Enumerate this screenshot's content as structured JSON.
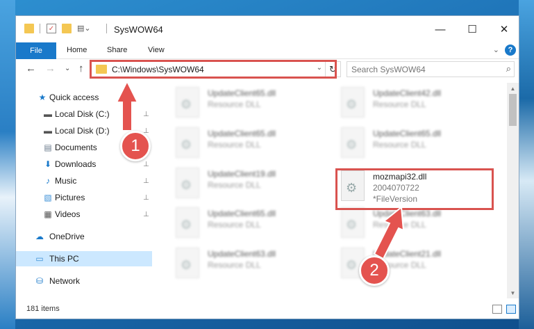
{
  "window": {
    "title": "SysWOW64",
    "minimize": "—",
    "maximize": "☐",
    "close": "✕"
  },
  "ribbon": {
    "tabs": [
      "File",
      "Home",
      "Share",
      "View"
    ],
    "expand": "⌄",
    "help": "?"
  },
  "nav": {
    "back": "←",
    "forward": "→",
    "recent": "⌄",
    "up": "↑",
    "address": "C:\\Windows\\SysWOW64",
    "address_dropdown": "⌄",
    "refresh": "↻",
    "search_placeholder": "Search SysWOW64",
    "search_icon": "⌕"
  },
  "sidebar": {
    "items": [
      {
        "label": "Quick access",
        "icon": "★",
        "icon_name": "star-icon",
        "pinned": false
      },
      {
        "label": "Local Disk (C:)",
        "icon": "▬",
        "icon_name": "drive-icon",
        "pinned": true
      },
      {
        "label": "Local Disk (D:)",
        "icon": "▬",
        "icon_name": "drive-icon",
        "pinned": true
      },
      {
        "label": "Documents",
        "icon": "▤",
        "icon_name": "documents-icon",
        "pinned": true
      },
      {
        "label": "Downloads",
        "icon": "⬇",
        "icon_name": "downloads-icon",
        "pinned": true
      },
      {
        "label": "Music",
        "icon": "♪",
        "icon_name": "music-icon",
        "pinned": true
      },
      {
        "label": "Pictures",
        "icon": "▧",
        "icon_name": "pictures-icon",
        "pinned": true
      },
      {
        "label": "Videos",
        "icon": "▦",
        "icon_name": "videos-icon",
        "pinned": true
      },
      {
        "label": "OneDrive",
        "icon": "☁",
        "icon_name": "onedrive-icon",
        "pinned": false
      },
      {
        "label": "This PC",
        "icon": "▭",
        "icon_name": "computer-icon",
        "pinned": false
      },
      {
        "label": "Network",
        "icon": "⛁",
        "icon_name": "network-icon",
        "pinned": false
      }
    ],
    "pin_glyph": "📌"
  },
  "files": [
    {
      "name": "UpdateClient65.dll",
      "sub1": "Resource DLL",
      "sub2": ""
    },
    {
      "name": "UpdateClient42.dll",
      "sub1": "Resource DLL",
      "sub2": ""
    },
    {
      "name": "UpdateClient65.dll",
      "sub1": "Resource DLL",
      "sub2": ""
    },
    {
      "name": "UpdateClient65.dll",
      "sub1": "Resource DLL",
      "sub2": ""
    },
    {
      "name": "UpdateClient19.dll",
      "sub1": "Resource DLL",
      "sub2": ""
    },
    {
      "name": "mozmapi32.dll",
      "sub1": "2004070722",
      "sub2": "*FileVersion"
    },
    {
      "name": "UpdateClient65.dll",
      "sub1": "Resource DLL",
      "sub2": ""
    },
    {
      "name": "UpdateClient63.dll",
      "sub1": "Resource DLL",
      "sub2": ""
    },
    {
      "name": "UpdateClient63.dll",
      "sub1": "Resource DLL",
      "sub2": ""
    },
    {
      "name": "UpdateClient21.dll",
      "sub1": "Resource DLL",
      "sub2": ""
    }
  ],
  "status": {
    "item_count": "181 items"
  },
  "callouts": [
    "1",
    "2"
  ],
  "colors": {
    "accent": "#1979ca",
    "highlight": "#d9534f",
    "selected": "#cce8ff"
  }
}
